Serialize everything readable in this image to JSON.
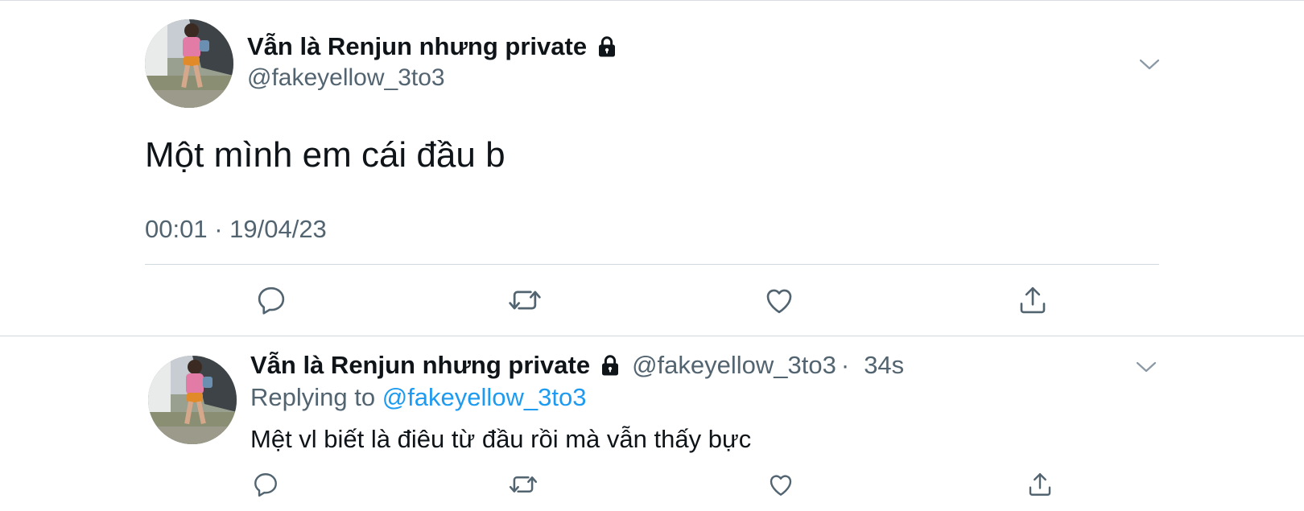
{
  "main_tweet": {
    "display_name": "Vẫn là Renjun nhưng private",
    "handle": "@fakeyellow_3to3",
    "text": "Một mình em cái đầu b",
    "timestamp": "00:01 · 19/04/23"
  },
  "reply_tweet": {
    "display_name": "Vẫn là Renjun nhưng private",
    "handle": "@fakeyellow_3to3",
    "separator": "·",
    "time_ago": "34s",
    "replying_label": "Replying to",
    "replying_to": "@fakeyellow_3to3",
    "text": "Mệt vl biết là điêu từ đầu rồi mà vẫn thấy bực"
  },
  "icons": {
    "lock": "lock-icon",
    "chevron": "chevron-down-icon",
    "reply": "reply-icon",
    "retweet": "retweet-icon",
    "like": "heart-icon",
    "share": "share-icon"
  },
  "colors": {
    "text_primary": "#0f1419",
    "text_secondary": "#536471",
    "mention_link": "#1d9bf0",
    "divider": "#cfd9de"
  }
}
